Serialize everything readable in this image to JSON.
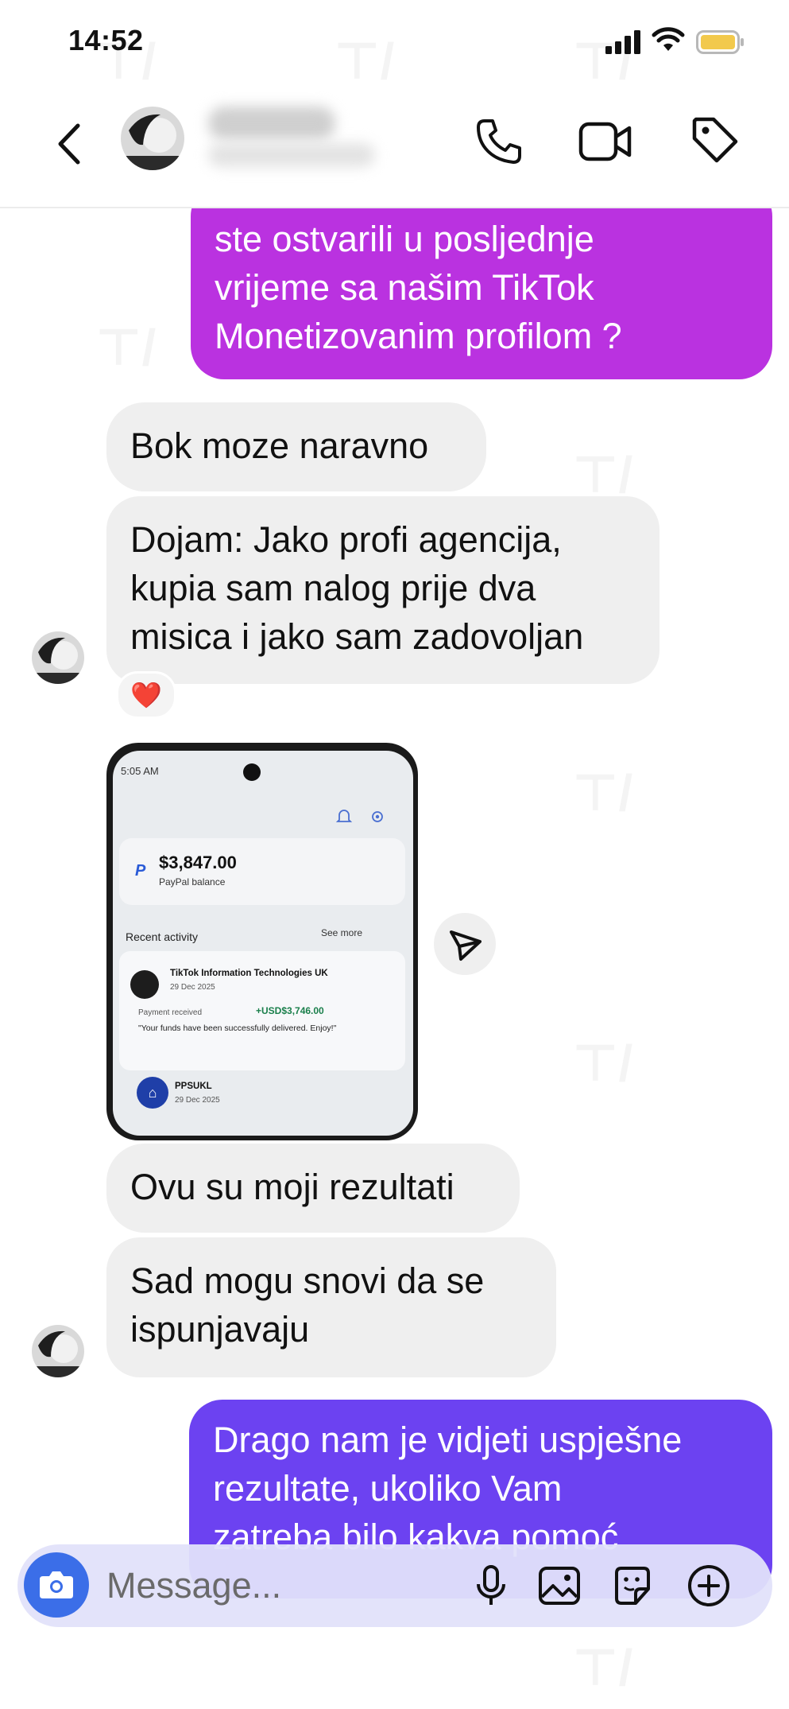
{
  "status_bar": {
    "time": "14:52"
  },
  "composer": {
    "placeholder": "Message..."
  },
  "messages": {
    "out_1": [
      "ste ostvarili u posljednje",
      "vrijeme sa našim TikTok",
      "Monetizovanim profilom ?"
    ],
    "in_1": "Bok moze naravno",
    "in_2": [
      "Dojam: Jako profi agencija,",
      "kupia sam nalog prije dva",
      "misica i jako sam zadovoljan"
    ],
    "reaction": "❤️",
    "in_3": "Ovu su moji rezultati",
    "in_4": [
      "Sad mogu snovi da se",
      "ispunjavaju"
    ],
    "out_2": [
      "Drago nam je vidjeti uspješne",
      "rezultate, ukoliko Vam",
      "zatreba bilo kakva pomoć"
    ]
  },
  "screenshot": {
    "status_time": "5:05 AM",
    "balance": "$3,847.00",
    "balance_label": "PayPal balance",
    "recent_activity": "Recent activity",
    "see_more": "See more",
    "tx1_name": "TikTok Information Technologies UK",
    "tx1_date": "29 Dec 2025",
    "tx1_status": "Payment received",
    "tx1_amount": "+USD$3,746.00",
    "tx1_note": "\"Your funds have been successfully delivered. Enjoy!\"",
    "tx2_name": "PPSUKL",
    "tx2_date": "29 Dec 2025"
  },
  "colors": {
    "outgoing_purple": "#ba32e0",
    "outgoing_blue": "#6c42f1",
    "incoming_gray": "#efefef",
    "camera_blue": "#3b6ee8",
    "paypal_green": "#1a7f4b"
  },
  "icons": [
    "back-chevron-icon",
    "phone-icon",
    "video-camera-icon",
    "tag-icon",
    "heart-reaction",
    "share-send-icon",
    "camera-icon",
    "microphone-icon",
    "image-gallery-icon",
    "sticker-icon",
    "plus-icon"
  ]
}
